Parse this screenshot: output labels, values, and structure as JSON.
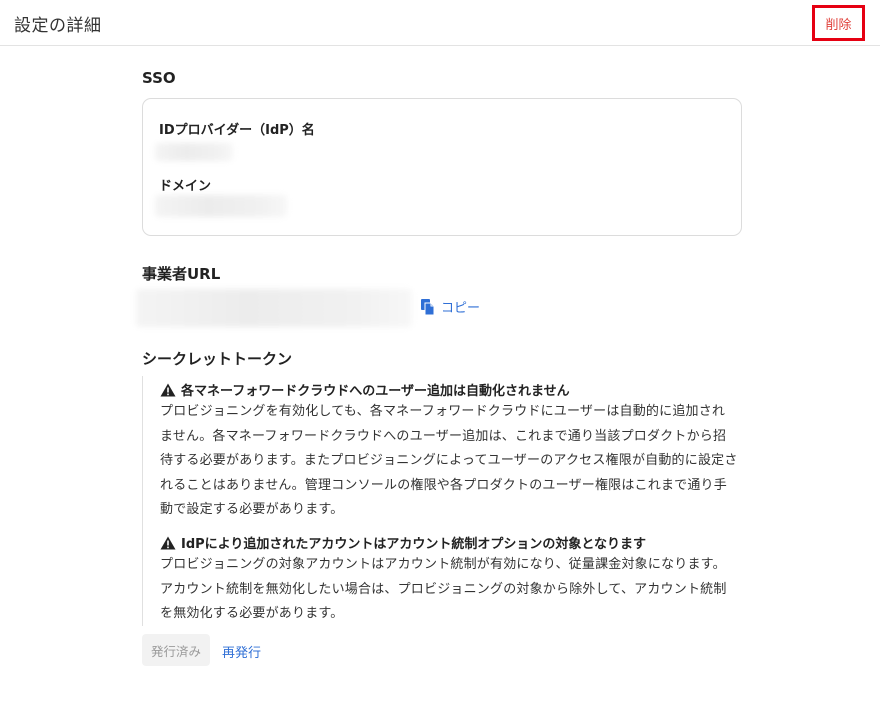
{
  "header": {
    "title": "設定の詳細",
    "delete_label": "削除"
  },
  "sso": {
    "section_title": "SSO",
    "idp_label": "IDプロバイダー（IdP）名",
    "domain_label": "ドメイン"
  },
  "business_url": {
    "section_title": "事業者URL",
    "copy_label": "コピー"
  },
  "secret_token": {
    "section_title": "シークレットトークン",
    "notice1_title": "各マネーフォワードクラウドへのユーザー追加は自動化されません",
    "notice1_body": "プロビジョニングを有効化しても、各マネーフォワードクラウドにユーザーは自動的に追加されません。各マネーフォワードクラウドへのユーザー追加は、これまで通り当該プロダクトから招待する必要があります。またプロビジョニングによってユーザーのアクセス権限が自動的に設定されることはありません。管理コンソールの権限や各プロダクトのユーザー権限はこれまで通り手動で設定する必要があります。",
    "notice2_title": "IdPにより追加されたアカウントはアカウント統制オプションの対象となります",
    "notice2_body": "プロビジョニングの対象アカウントはアカウント統制が有効になり、従量課金対象になります。アカウント統制を無効化したい場合は、プロビジョニングの対象から除外して、アカウント統制を無効化する必要があります。",
    "issued_label": "発行済み",
    "reissue_label": "再発行"
  },
  "colors": {
    "accent_link": "#2f6fd6",
    "delete_text": "#e0423c",
    "highlight_border": "#e60012"
  },
  "icons": {
    "copy": "copy-icon",
    "warning": "warning-icon"
  }
}
